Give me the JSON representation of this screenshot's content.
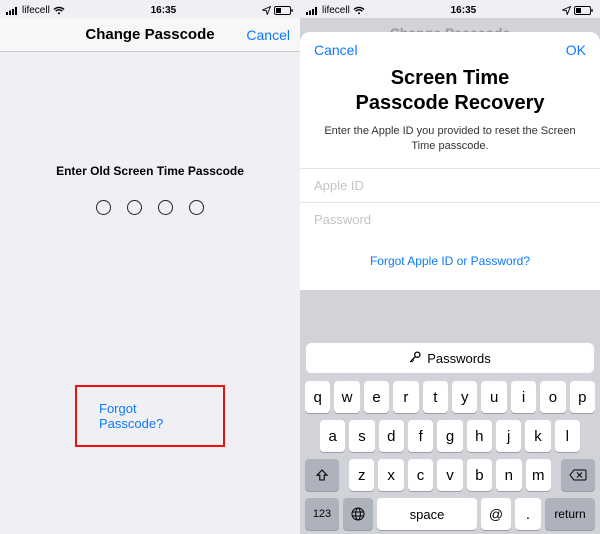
{
  "status": {
    "carrier": "lifecell",
    "time": "16:35"
  },
  "left": {
    "nav_title": "Change Passcode",
    "nav_cancel": "Cancel",
    "prompt": "Enter Old Screen Time Passcode",
    "forgot": "Forgot Passcode?"
  },
  "right": {
    "dim_title": "Change Passcode",
    "sheet_cancel": "Cancel",
    "sheet_ok": "OK",
    "title_line1": "Screen Time",
    "title_line2": "Passcode Recovery",
    "subtitle": "Enter the Apple ID you provided to reset the Screen Time passcode.",
    "field_appleid": "Apple ID",
    "field_password": "Password",
    "forgot_apple": "Forgot Apple ID or Password?",
    "autofill": "Passwords"
  },
  "keyboard": {
    "row1": [
      "q",
      "w",
      "e",
      "r",
      "t",
      "y",
      "u",
      "i",
      "o",
      "p"
    ],
    "row2": [
      "a",
      "s",
      "d",
      "f",
      "g",
      "h",
      "j",
      "k",
      "l"
    ],
    "row3": [
      "z",
      "x",
      "c",
      "v",
      "b",
      "n",
      "m"
    ],
    "k123": "123",
    "space": "space",
    "at": "@",
    "dot": ".",
    "ret": "return"
  }
}
